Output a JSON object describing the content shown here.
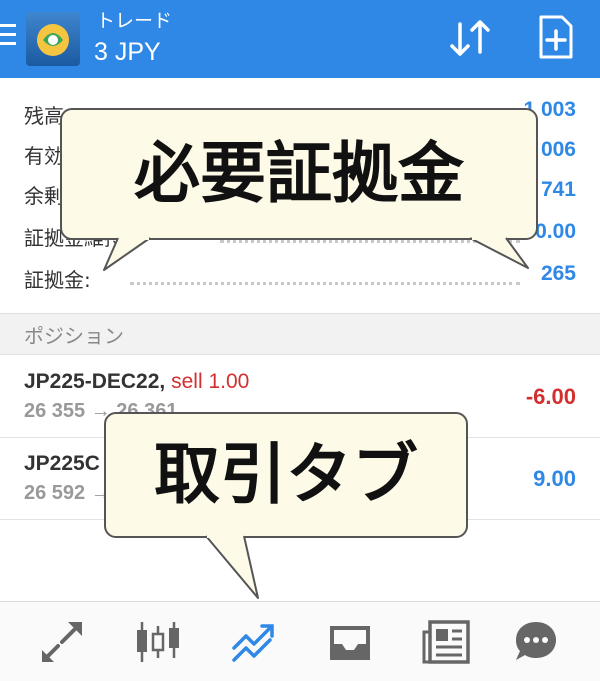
{
  "header": {
    "subtitle": "トレード",
    "title": "3 JPY"
  },
  "account": {
    "rows": [
      {
        "label": "残高:",
        "value": "1 003"
      },
      {
        "label": "有効",
        "value": "1 006"
      },
      {
        "label": "余剰",
        "value": "741"
      },
      {
        "label": "証拠金維持",
        "value": "380.00"
      },
      {
        "label": "証拠金:",
        "value": "265"
      }
    ]
  },
  "section": {
    "label": "ポジション"
  },
  "positions": [
    {
      "symbol": "JP225-DEC22,",
      "side": "sell 1.00",
      "prices": "26 355 → 26 361",
      "profit": "-6.00",
      "profit_color": "#d32f2f"
    },
    {
      "symbol": "JP225C",
      "side": "",
      "prices": "26 592 →",
      "profit": "9.00",
      "profit_color": "#2f88e6"
    }
  ],
  "callouts": {
    "margin": "必要証拠金",
    "trade_tab": "取引タブ"
  },
  "colors": {
    "header_bg": "#2f88e6",
    "accent_blue": "#2f88e6",
    "loss_red": "#d32f2f",
    "callout_bg": "#fdfbe8"
  },
  "tabs": [
    {
      "icon": "quotes-arrows-icon"
    },
    {
      "icon": "candlestick-chart-icon"
    },
    {
      "icon": "trade-trend-icon",
      "active": true
    },
    {
      "icon": "history-inbox-icon"
    },
    {
      "icon": "news-icon"
    },
    {
      "icon": "chat-icon"
    }
  ]
}
